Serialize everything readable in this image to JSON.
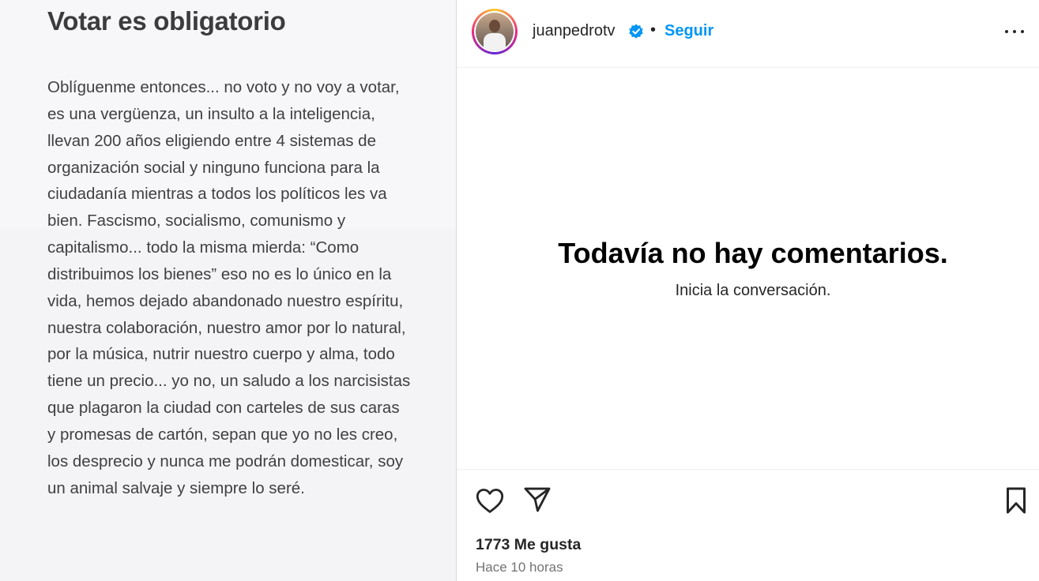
{
  "post_image": {
    "title": "Votar es obligatorio",
    "paragraph": "Oblíguenme entonces... no voto y no voy a votar, es una vergüenza, un insulto a la inteligencia, llevan 200 años eligiendo entre 4 sistemas de organización social y ninguno funciona para la ciudadanía mientras a todos los políticos les va bien. Fascismo, socialismo, comunismo y capitalismo... todo la misma mierda: “Como distribuimos los bienes” eso no es lo único en la vida, hemos dejado abandonado nuestro espíritu, nuestra colaboración, nuestro amor por lo natural, por la música, nutrir nuestro cuerpo y alma, todo tiene un precio... yo no, un saludo a los narcisistas que plagaron la ciudad con carteles de sus caras y promesas de cartón, sepan que yo no les creo, los desprecio y nunca me podrán domesticar, soy un animal salvaje y siempre lo seré."
  },
  "header": {
    "username": "juanpedrotv",
    "separator": "•",
    "follow_label": "Seguir",
    "verified_icon": "verified-badge-icon",
    "more_icon": "more-options-icon"
  },
  "comments": {
    "empty_title": "Todavía no hay comentarios.",
    "empty_subtitle": "Inicia la conversación."
  },
  "actions": {
    "like_icon": "heart-icon",
    "share_icon": "paper-plane-icon",
    "save_icon": "bookmark-icon"
  },
  "stats": {
    "likes": "1773 Me gusta",
    "time": "Hace 10 horas"
  },
  "colors": {
    "accent": "#0095f6",
    "verified": "#0095f6"
  }
}
